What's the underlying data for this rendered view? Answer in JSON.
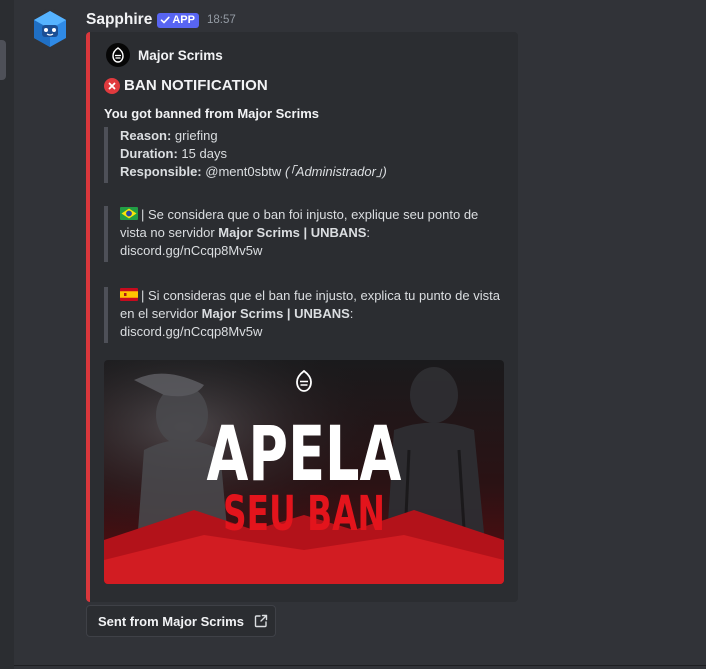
{
  "message": {
    "username": "Sapphire",
    "badge": "APP",
    "timestamp": "18:57"
  },
  "embed": {
    "accent_color": "#da373c",
    "author": "Major Scrims",
    "title": "BAN NOTIFICATION",
    "subtitle": "You got banned from Major Scrims",
    "details": {
      "reason_label": "Reason:",
      "reason_value": "griefing",
      "duration_label": "Duration:",
      "duration_value": "15 days",
      "responsible_label": "Responsible:",
      "responsible_value": "@ment0sbtw",
      "responsible_role": "(「Administrador」)"
    },
    "pt_message": {
      "text1": "| Se considera que o ban foi injusto, explique seu ponto de vista no servidor ",
      "server": "Major Scrims | UNBANS",
      "text2": ":",
      "link": "discord.gg/nCcqp8Mv5w"
    },
    "es_message": {
      "text1": "| Si consideras que el ban fue injusto, explica tu punto de vista en el servidor ",
      "server": "Major Scrims | UNBANS",
      "text2": ":",
      "link": "discord.gg/nCcqp8Mv5w"
    },
    "banner": {
      "line1": "APELA",
      "line2": "SEU BAN"
    }
  },
  "footer_button": {
    "label": "Sent from Major Scrims"
  },
  "icons": [
    "bot-avatar-icon",
    "verified-check-icon",
    "author-logo-icon",
    "cross-mark-icon",
    "brazil-flag-icon",
    "spain-flag-icon",
    "external-link-icon"
  ]
}
